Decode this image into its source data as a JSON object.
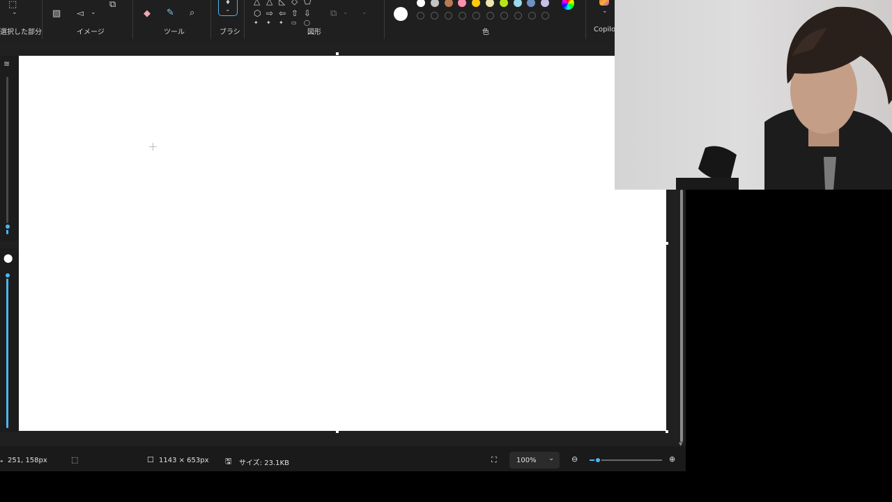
{
  "ribbon": {
    "groups": {
      "selection": "選択した部分",
      "image": "イメージ",
      "tools": "ツール",
      "brushes": "ブラシ",
      "shapes": "図形",
      "colors": "色",
      "copilot": "Copilot"
    },
    "color_swatches": [
      "#ffffff",
      "#c3c3c3",
      "#b97a57",
      "#ff8fab",
      "#ffc90e",
      "#efe4b0",
      "#b5e61d",
      "#99d9ea",
      "#7092be",
      "#c8bfe7"
    ],
    "active_color": "#ffffff"
  },
  "status": {
    "cursor_position": "251, 158px",
    "canvas_size": "1143 × 653px",
    "file_size": "サイズ: 23.1KB",
    "zoom": "100%"
  },
  "accent_color": "#4cb6f0"
}
